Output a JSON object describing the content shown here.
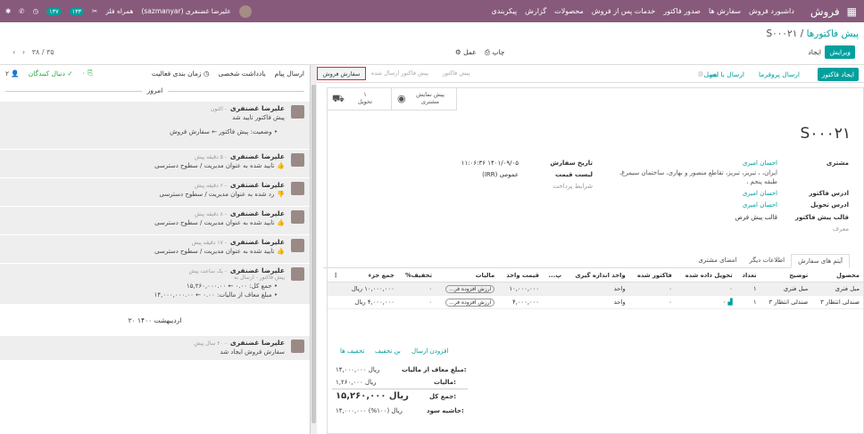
{
  "navbar": {
    "app": "فروش",
    "menu": [
      "داشبورد فروش",
      "سفارش ها",
      "صدور فاکتور",
      "خدمات پس از فروش",
      "محصولات",
      "گزارش",
      "پیکربندی"
    ],
    "user": "علیرضا غضنفری (sazmanyar)",
    "company": "همراه فلز",
    "badge1": "۱۳۳",
    "badge2": "۱۳۷"
  },
  "breadcrumb": {
    "parent": "پیش فاکتورها",
    "current": "S۰۰۰۲۱"
  },
  "buttons": {
    "edit": "ویرایش",
    "create": "ایجاد",
    "print": "چاپ",
    "action": "عمل",
    "create_invoice": "ایجاد فاکتور",
    "send_proforma": "ارسال پروفرما",
    "send_email": "ارسال با ایمیل",
    "cancel": "لغو"
  },
  "pager": "۳۸ / ۳۵",
  "statusbar": [
    "سفارش فروش",
    "پیش فاکتور ارسال شده",
    "پیش فاکتور"
  ],
  "smart": {
    "preview_label": "پیش نمایش",
    "preview_sub": "مشتری",
    "delivery_count": "۱",
    "delivery_label": "تحویل"
  },
  "order": {
    "name": "S۰۰۰۲۱",
    "customer_label": "مشتری",
    "customer": "احسان امیری",
    "address": "ایران، ، تبریز، تبریز، تقاطع منصور و بهاری، ساختمان سیمرغ، طبقه پنجم ،",
    "inv_label": "ادرس فاکتور",
    "inv": "احسان امیری",
    "del_label": "ادرس تحویل",
    "del": "احسان امیری",
    "tpl_label": "قالب پیش فاکتور",
    "tpl": "قالب پیش فرض",
    "ref_label": "معرف",
    "date_label": "تاریخ سفارش",
    "date": "۱۴۰۱/۰۹/۰۵ ۱۱:۰۶:۳۶",
    "pl_label": "لیست قیمت",
    "pl": "عمومی (IRR)",
    "terms_label": "شرایط پرداخت"
  },
  "tabs": [
    "آیتم های سفارش",
    "اطلاعات دیگر",
    "امضای مشتری"
  ],
  "headers": [
    "محصول",
    "توضیح",
    "تعداد",
    "تحویل داده شده",
    "فاکتور شده",
    "واحد اندازه گیری",
    "پ...",
    "قیمت واحد",
    "مالیات",
    "تخفیف%",
    "جمع جزء"
  ],
  "lines": [
    {
      "product": "مبل فنری",
      "desc": "مبل فنری",
      "qty": "۱",
      "delivered": "۰",
      "invoiced": "۰",
      "uom": "واحد",
      "price": "۱۰,۰۰۰,۰۰۰",
      "tax": "ارزش افزوده فر...",
      "disc": "۰",
      "sub": "۱۰,۰۰۰,۰۰۰ ریال"
    },
    {
      "product": "صندلی انتظار ۳",
      "desc": "صندلی انتظار ۳",
      "qty": "۱",
      "delivered": "۰",
      "invoiced": "۰",
      "uom": "واحد",
      "price": "۴,۰۰۰,۰۰۰",
      "tax": "ارزش افزوده فر...",
      "disc": "۰",
      "sub": "۴,۰۰۰,۰۰۰ ریال"
    }
  ],
  "links": {
    "shipping": "افزودن ارسال",
    "coupon": "بن تخفیف",
    "promo": "تخفیف ها"
  },
  "totals": {
    "untaxed_label": "مبلغ معاف از مالیات:",
    "untaxed": "۱۴,۰۰۰,۰۰۰ ریال",
    "tax_label": "مالیات:",
    "tax": "۱,۲۶۰,۰۰۰ ریال",
    "total_label": "جمع کل:",
    "total": "۱۵,۲۶۰,۰۰۰ ریال",
    "margin_label": "حاشیه سود:",
    "margin": "۱۴,۰۰۰,۰۰۰ ریال (۱۰۰%)"
  },
  "chatter": {
    "send": "ارسال پیام",
    "note": "یادداشت شخصی",
    "schedule": "زمان بندی فعالیت",
    "attach": "۰",
    "follow": "دنبال کنندگان",
    "followers": "۲",
    "today": "امروز",
    "date2": "۲۰ اردیبهشت ۱۴۰۰"
  },
  "messages": [
    {
      "author": "علیرضا غضنفری",
      "time": "- اکنون",
      "body": "پیش فاکتور تایید شد",
      "extra": "وضعیت: پیش فاکتور ← سفارش فروش"
    },
    {
      "author": "علیرضا غضنفری",
      "time": "- ۵ دقیقه پیش",
      "body": "تایید شده به عنوان مدیریت / سطوح دسترسی"
    },
    {
      "author": "علیرضا غضنفری",
      "time": "- ۶ دقیقه پیش",
      "body": "رد شده به عنوان مدیریت / سطوح دسترسی"
    },
    {
      "author": "علیرضا غضنفری",
      "time": "- ۸ دقیقه پیش",
      "body": "تایید شده به عنوان مدیریت / سطوح دسترسی"
    },
    {
      "author": "علیرضا غضنفری",
      "time": "- ۱۷ دقیقه پیش",
      "body": "تایید شده به عنوان مدیریت / سطوح دسترسی"
    },
    {
      "author": "علیرضا غضنفری",
      "time": "- یک ساعت پیش",
      "sub": "پیش فاکتور - ارسال به",
      "body": "جمع کل: ۰.۰۰ ← ۱۵,۲۶۰,۰۰۰.۰۰",
      "extra": "مبلغ معاف از مالیات: ۰.۰۰ ← ۱۴,۰۰۰,۰۰۰.۰۰"
    },
    {
      "author": "علیرضا غضنفری",
      "time": "- ۲۰ سال پیش",
      "body": "سفارش فروش ایجاد شد"
    }
  ]
}
